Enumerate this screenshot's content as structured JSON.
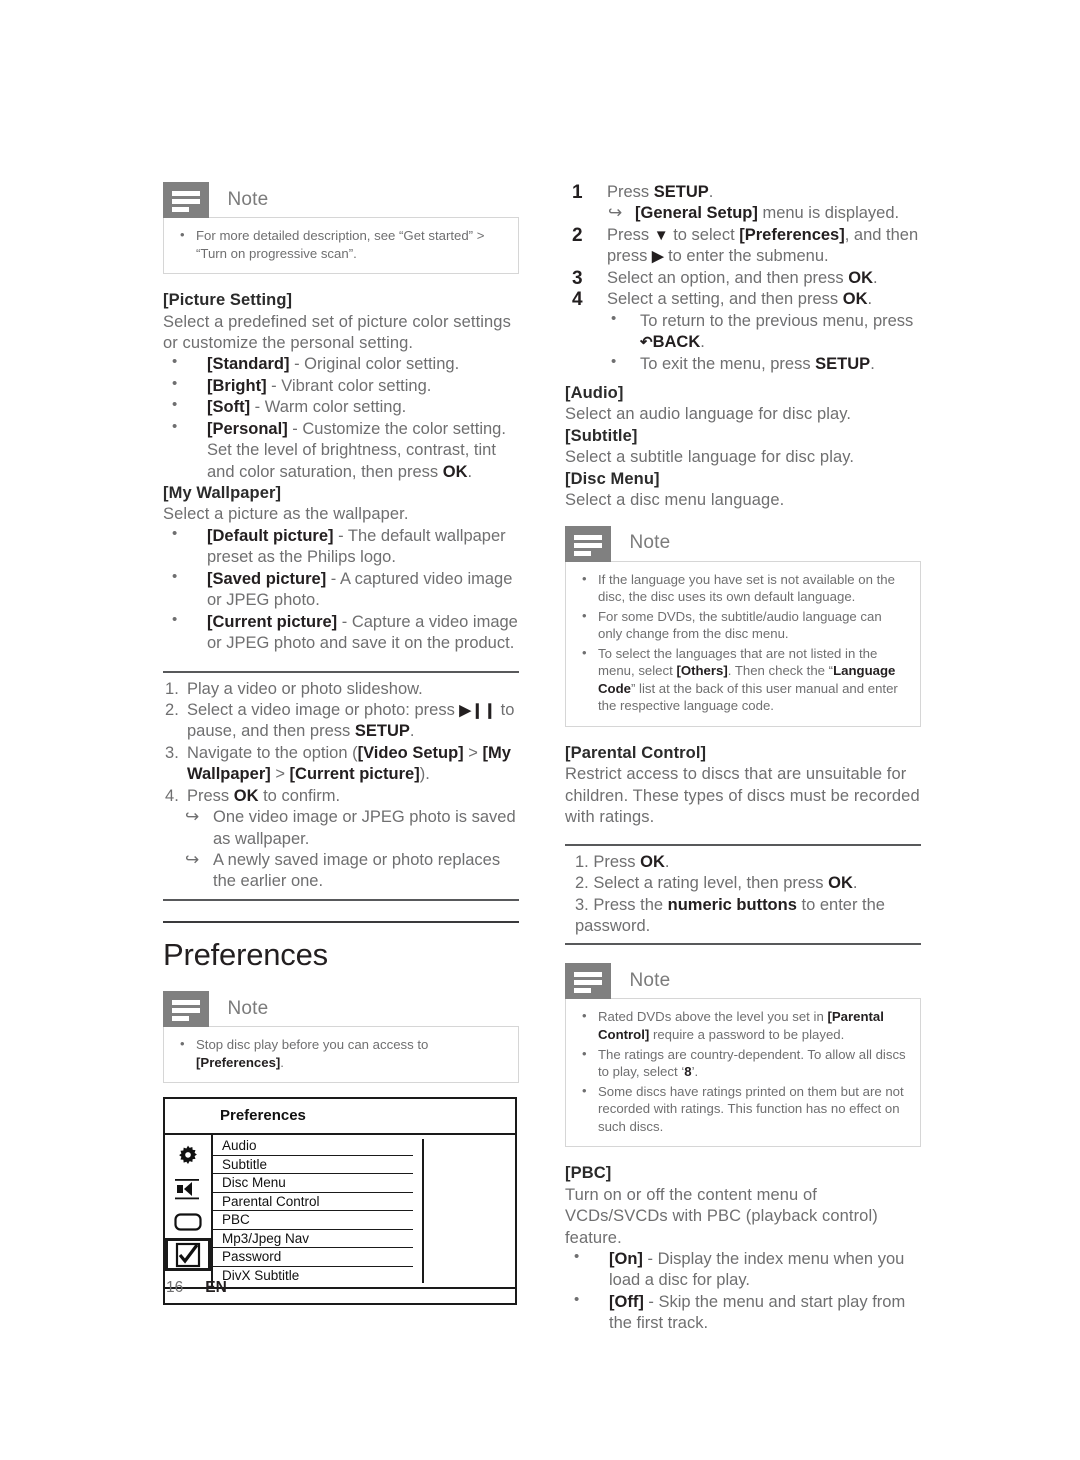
{
  "page": {
    "number": "16",
    "language_code": "EN"
  },
  "left_column": {
    "note_progressive": {
      "title": "Note",
      "items": [
        "For more detailed description, see “Get started” > “Turn on progressive scan”."
      ]
    },
    "picture_setting": {
      "heading": "[Picture Setting]",
      "intro": "Select a predefined set of picture color settings or customize the personal setting.",
      "options": [
        {
          "term": "[Standard]",
          "desc": " - Original color setting."
        },
        {
          "term": "[Bright]",
          "desc": " - Vibrant color setting."
        },
        {
          "term": "[Soft]",
          "desc": " - Warm color setting."
        },
        {
          "term": "[Personal]",
          "desc": " - Customize the color setting. Set the level of brightness, contrast, tint and color saturation, then press ",
          "bold_tail": "OK",
          "tail": "."
        }
      ]
    },
    "my_wallpaper": {
      "heading": "[My Wallpaper]",
      "intro": "Select a picture as the wallpaper.",
      "options": [
        {
          "term": "[Default picture]",
          "desc": " - The default wallpaper preset as the Philips logo."
        },
        {
          "term": "[Saved picture]",
          "desc": " - A captured video image or JPEG photo."
        },
        {
          "term": "[Current picture]",
          "desc": " - Capture a video image or JPEG photo and save it on the product."
        }
      ]
    },
    "wallpaper_procedure": {
      "steps": [
        {
          "text": "Play a video or photo slideshow."
        },
        {
          "pre": "Select a video image or photo: press ",
          "glyph": "▶❙❙",
          "mid": " to pause, and then press ",
          "bold": "SETUP",
          "post": "."
        },
        {
          "pre": "Navigate to the option (",
          "bold": "[Video Setup]",
          "mid": " > ",
          "bold2": "[My Wallpaper]",
          "mid2": " > ",
          "bold3": "[Current picture]",
          "post": ")."
        },
        {
          "pre": "Press ",
          "bold": "OK",
          "post": " to confirm."
        }
      ],
      "results": [
        "One video image or JPEG photo is saved as wallpaper.",
        "A newly saved image or photo replaces the earlier one."
      ]
    },
    "preferences_section": {
      "heading": "Preferences",
      "note": {
        "title": "Note",
        "items_pre": "Stop disc play before you can access to ",
        "items_bold": "[Preferences]",
        "items_post": "."
      }
    },
    "menu_mockup": {
      "title": "Preferences",
      "icons": [
        "gear-icon",
        "speaker-icon",
        "screen-icon",
        "checkbox-icon"
      ],
      "selected_icon_index": 3,
      "rows": [
        "Audio",
        "Subtitle",
        "Disc Menu",
        "Parental Control",
        "PBC",
        "Mp3/Jpeg Nav",
        "Password",
        "DivX Subtitle"
      ]
    }
  },
  "right_column": {
    "steps": [
      {
        "num": "1",
        "pre": "Press ",
        "bold": "SETUP",
        "post": "."
      },
      {
        "num": "2",
        "pre": "Press ",
        "glyph": "▼",
        "mid": " to select ",
        "bold": "[Preferences]",
        "post": ", and then press ",
        "glyph2": "▶",
        "post2": " to enter the submenu."
      },
      {
        "num": "3",
        "pre": "Select an option, and then press ",
        "bold": "OK",
        "post": "."
      },
      {
        "num": "4",
        "pre": "Select a setting, and then press ",
        "bold": "OK",
        "post": "."
      }
    ],
    "step1_arrow": {
      "bold": "[General Setup]",
      "post": " menu is displayed."
    },
    "step4_bullets": [
      {
        "pre": "To return to the previous menu, press ",
        "glyph": "↶",
        "bold": "BACK",
        "post": "."
      },
      {
        "pre": "To exit the menu, press ",
        "bold": "SETUP",
        "post": "."
      }
    ],
    "audio": {
      "heading": "[Audio]",
      "text": "Select an audio language for disc play."
    },
    "subtitle": {
      "heading": "[Subtitle]",
      "text": "Select a subtitle language for disc play."
    },
    "disc_menu": {
      "heading": "[Disc Menu]",
      "text": "Select a disc menu language."
    },
    "note_language": {
      "title": "Note",
      "items": [
        {
          "text": "If the language you have set is not available on the disc, the disc uses its own default language."
        },
        {
          "text": "For some DVDs, the subtitle/audio language can only change from the disc menu."
        },
        {
          "pre": "To select the languages that are not listed in the menu, select ",
          "bold": "[Others]",
          "mid": ". Then check the “",
          "bold2": "Language Code",
          "post": "” list at the back of this user manual and enter the respective language code."
        }
      ]
    },
    "parental_control": {
      "heading": "[Parental Control]",
      "text": "Restrict access to discs that are unsuitable for children. These types of discs must be recorded with ratings.",
      "procedure": [
        {
          "pre": "1. Press ",
          "bold": "OK",
          "post": "."
        },
        {
          "pre": "2. Select a rating level, then press ",
          "bold": "OK",
          "post": "."
        },
        {
          "pre": "3. Press the ",
          "bold": "numeric buttons",
          "post": " to enter the password."
        }
      ]
    },
    "note_ratings": {
      "title": "Note",
      "items": [
        {
          "pre": "Rated DVDs above the level you set in ",
          "bold": "[Parental Control]",
          "post": " require a password to be played."
        },
        {
          "pre": "The ratings are country-dependent. To allow all discs to play, select ‘",
          "bold": "8",
          "post": "’."
        },
        {
          "pre": "Some discs have ratings printed on them but are not recorded with ratings. This function has no effect on such discs.",
          "bold": "",
          "post": ""
        }
      ]
    },
    "pbc": {
      "heading": "[PBC]",
      "intro": "Turn on or off the content menu of VCDs/SVCDs with PBC (playback control) feature.",
      "options": [
        {
          "term": "[On]",
          "desc": " - Display the index menu when you load a disc for play."
        },
        {
          "term": "[Off]",
          "desc": " - Skip the menu and start play from the first track."
        }
      ]
    }
  }
}
